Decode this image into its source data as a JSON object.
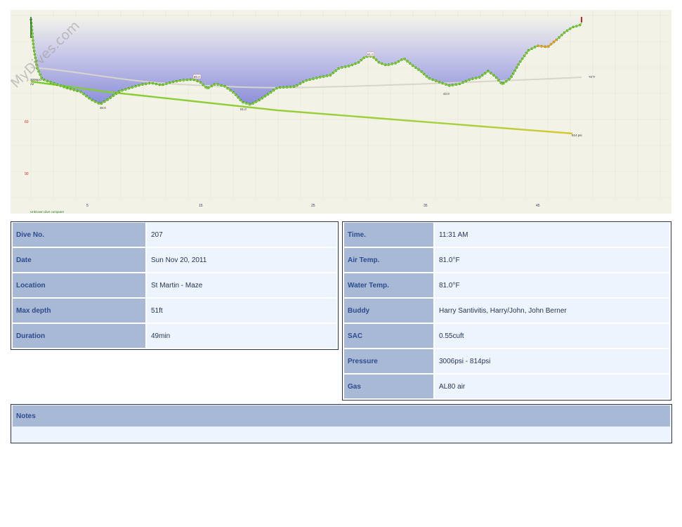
{
  "profile": {
    "watermark": "MyDives.com",
    "start_pressure_label": "3006psi",
    "gas_label": "Air",
    "end_pressure_label": "814 psi",
    "depth_axis_labels": [
      "60",
      "90"
    ],
    "time_axis_labels": [
      "5",
      "15",
      "25",
      "35",
      "45"
    ],
    "depth_markers": [
      "30.0",
      "51.0",
      "42.0"
    ],
    "temp_markers": [
      "80.0",
      "81.0"
    ],
    "right_temp_label": "78°F",
    "computer_label": "Unknown dive computer",
    "colors": {
      "background": "#f3f2e6",
      "fill_top": "#f2f2ea",
      "fill_bottom": "#8c8fd8",
      "depth_line": "#7ccc33",
      "pressure_line": "#8ccc3a",
      "temp_line": "#d8d6cc",
      "accent_red": "#d02020"
    }
  },
  "dive_info": [
    {
      "label": "Dive No.",
      "value": "207"
    },
    {
      "label": "Date",
      "value": "Sun Nov 20, 2011"
    },
    {
      "label": "Location",
      "value": "St Martin - Maze"
    },
    {
      "label": "Max depth",
      "value": "51ft"
    },
    {
      "label": "Duration",
      "value": "49min"
    }
  ],
  "conditions": [
    {
      "label": "Time.",
      "value": "11:31 AM"
    },
    {
      "label": "Air Temp.",
      "value": "81.0°F"
    },
    {
      "label": "Water Temp.",
      "value": "81.0°F"
    },
    {
      "label": "Buddy",
      "value": "Harry Santivitis, Harry/John, John Berner"
    },
    {
      "label": "SAC",
      "value": "0.55cuft"
    },
    {
      "label": "Pressure",
      "value": "3006psi - 814psi"
    },
    {
      "label": "Gas",
      "value": "AL80 air"
    }
  ],
  "notes": {
    "header": "Notes",
    "text": ""
  }
}
